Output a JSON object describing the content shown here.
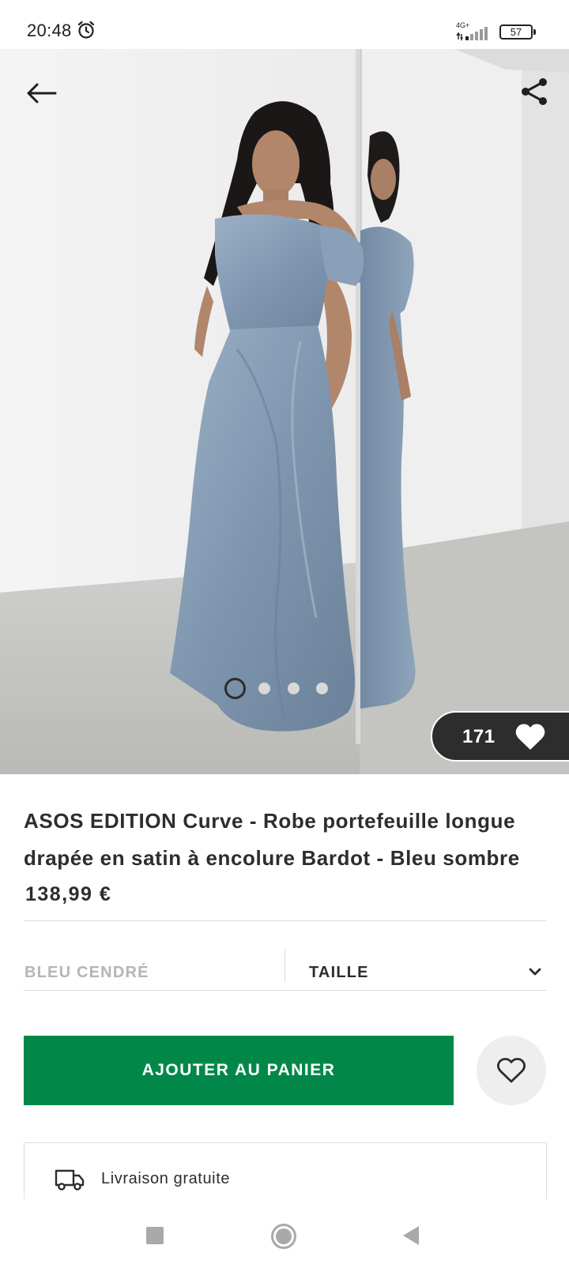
{
  "status_bar": {
    "time": "20:48",
    "network": "4G+",
    "battery": "57",
    "icons": [
      "alarm-icon",
      "signal-icon",
      "battery-icon"
    ]
  },
  "hero": {
    "image_description_icon": "product-photo",
    "nav_icons": [
      "arrow-left-icon",
      "share-icon"
    ],
    "carousel": {
      "count": 4,
      "active_index": 0
    },
    "favorites_count": "171"
  },
  "product": {
    "title": "ASOS EDITION Curve - Robe portefeuille longue drapée en satin à encolure Bardot - Bleu sombre",
    "price": "138,99 €",
    "color": "BLEU CENDRÉ",
    "size_label": "TAILLE"
  },
  "actions": {
    "add_to_cart": "AJOUTER AU PANIER",
    "brand_color": "#018849"
  },
  "delivery": {
    "text": "Livraison gratuite"
  }
}
